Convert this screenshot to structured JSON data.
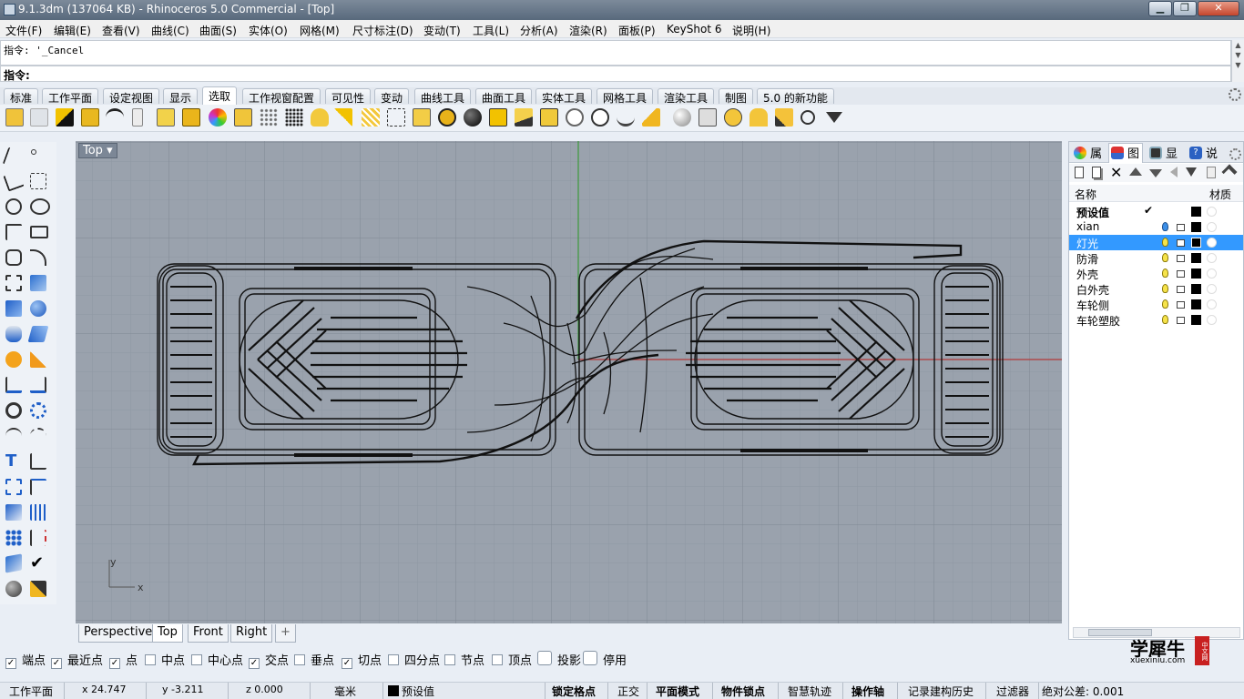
{
  "window": {
    "title": "9.1.3dm (137064 KB) - Rhinoceros 5.0 Commercial - [Top]",
    "minimize": "▁",
    "restore": "❐",
    "close": "✕"
  },
  "menu": [
    "文件(F)",
    "编辑(E)",
    "查看(V)",
    "曲线(C)",
    "曲面(S)",
    "实体(O)",
    "网格(M)",
    "尺寸标注(D)",
    "变动(T)",
    "工具(L)",
    "分析(A)",
    "渲染(R)",
    "面板(P)",
    "KeyShot 6",
    "说明(H)"
  ],
  "command": {
    "history": "指令: '_Cancel",
    "prompt": "指令:"
  },
  "toolbar_tabs": [
    "标准",
    "工作平面",
    "设定视图",
    "显示",
    "选取",
    "工作视窗配置",
    "可见性",
    "变动",
    "曲线工具",
    "曲面工具",
    "实体工具",
    "网格工具",
    "渲染工具",
    "制图",
    "5.0 的新功能"
  ],
  "active_tab": "选取",
  "viewport": {
    "label": "Top",
    "dropdown": "▾",
    "axis_y": "y",
    "axis_x": "x"
  },
  "viewport_tabs": [
    "Perspective",
    "Top",
    "Front",
    "Right"
  ],
  "add_tab": "+",
  "panel": {
    "tabs": [
      "属",
      "图",
      "显",
      "说"
    ],
    "col_name": "名称",
    "col_material": "材质",
    "layers": [
      {
        "name": "预设值",
        "current": "✔",
        "bold": true
      },
      {
        "name": "xian"
      },
      {
        "name": "灯光",
        "selected": true
      },
      {
        "name": "防滑"
      },
      {
        "name": "外壳"
      },
      {
        "name": "白外壳"
      },
      {
        "name": "车轮侧"
      },
      {
        "name": "车轮塑胶"
      }
    ]
  },
  "osnaps": [
    {
      "label": "端点",
      "checked": true
    },
    {
      "label": "最近点",
      "checked": true
    },
    {
      "label": "点",
      "checked": true
    },
    {
      "label": "中点",
      "checked": false
    },
    {
      "label": "中心点",
      "checked": false
    },
    {
      "label": "交点",
      "checked": true
    },
    {
      "label": "垂点",
      "checked": false
    },
    {
      "label": "切点",
      "checked": true
    },
    {
      "label": "四分点",
      "checked": false
    },
    {
      "label": "节点",
      "checked": false
    },
    {
      "label": "顶点",
      "checked": false
    },
    {
      "label": "投影",
      "checked": false
    },
    {
      "label": "停用",
      "checked": false
    }
  ],
  "status": {
    "cplane": "工作平面",
    "x": "x 24.747",
    "y": "y -3.211",
    "z": "z 0.000",
    "units": "毫米",
    "layer": "预设值",
    "items": [
      "锁定格点",
      "正交",
      "平面模式",
      "物件锁点",
      "智慧轨迹",
      "操作轴",
      "记录建构历史",
      "过滤器"
    ],
    "tolerance": "绝对公差: 0.001"
  },
  "logo": {
    "main": "学犀牛",
    "sub": "xuexiniu.com",
    "side": "中文网"
  }
}
